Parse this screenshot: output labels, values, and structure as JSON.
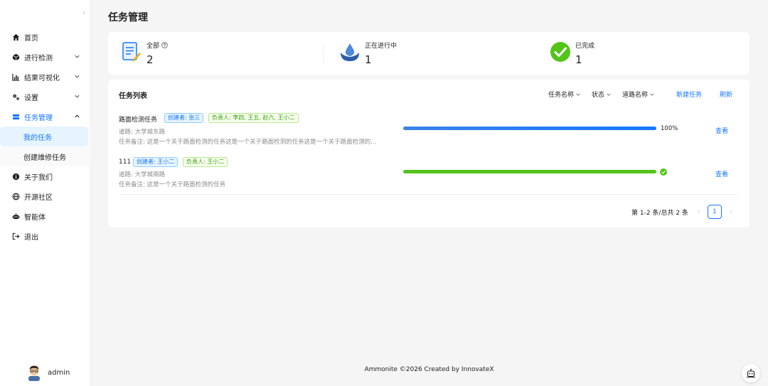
{
  "sidebar": {
    "collapse_glyph": "‹",
    "items": [
      {
        "label": "首页",
        "icon": "home-icon"
      },
      {
        "label": "进行检测",
        "icon": "cube-icon",
        "has_arrow": true
      },
      {
        "label": "结果可视化",
        "icon": "bar-chart-icon",
        "has_arrow": true
      },
      {
        "label": "设置",
        "icon": "gears-icon",
        "has_arrow": true
      },
      {
        "label": "任务管理",
        "icon": "database-icon",
        "has_arrow": true,
        "open": true
      },
      {
        "label": "关于我们",
        "icon": "info-icon"
      },
      {
        "label": "开源社区",
        "icon": "globe-icon"
      },
      {
        "label": "智能体",
        "icon": "robot-icon"
      },
      {
        "label": "退出",
        "icon": "logout-icon"
      }
    ],
    "submenu": [
      {
        "label": "我的任务",
        "active": true
      },
      {
        "label": "创建维修任务"
      }
    ],
    "user": {
      "name": "admin"
    }
  },
  "page": {
    "title": "任务管理"
  },
  "stats": [
    {
      "label": "全部",
      "value": "2",
      "icon": "document-edit-icon",
      "has_help": true
    },
    {
      "label": "正在进行中",
      "value": "1",
      "icon": "water-drop-icon"
    },
    {
      "label": "已完成",
      "value": "1",
      "icon": "check-circle-icon"
    }
  ],
  "task_list": {
    "title": "任务列表",
    "filters": [
      "任务名称",
      "状态",
      "道路名称"
    ],
    "new_task": "新建任务",
    "refresh": "刷新",
    "tasks": [
      {
        "name": "路面检测任务",
        "creator_tag": "创建者: 张三",
        "assignee_tag": "负责人: 李四, 王五, 赵六, 王小二",
        "road": "道路: 大学城东路",
        "note": "任务备注: 这是一个关于路面检测的任务这是一个关于路面检测的任务这是一个关于路面检测的...",
        "progress": 100,
        "progress_text": "100%",
        "status": "active",
        "view": "查看"
      },
      {
        "name": "111",
        "creator_tag": "创建者: 王小二",
        "assignee_tag": "负责人: 王小二",
        "road": "道路: 大学城南路",
        "note": "任务备注: 这是一个关于路面检测的任务",
        "progress": 100,
        "status": "success",
        "view": "查看"
      }
    ],
    "pagination": {
      "summary": "第 1-2 条/总共 2 条",
      "current": "1"
    }
  },
  "footer": {
    "text": "Ammonite ©2026 Created by InnovateX"
  },
  "colors": {
    "primary": "#1677ff",
    "success": "#52c41a",
    "progress_active": "#1677ff"
  }
}
